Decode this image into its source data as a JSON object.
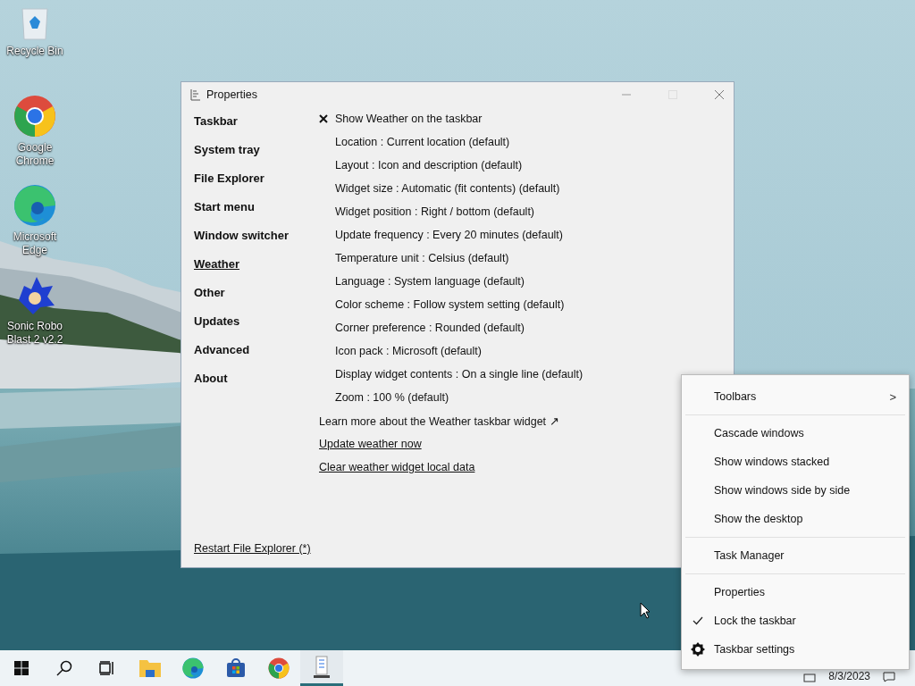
{
  "desktop_icons": [
    {
      "label": "Recycle Bin",
      "kind": "recycle"
    },
    {
      "label": "Google Chrome",
      "kind": "chrome"
    },
    {
      "label": "Microsoft Edge",
      "kind": "edge"
    },
    {
      "label": "Sonic Robo Blast 2 v2.2",
      "kind": "game"
    }
  ],
  "window": {
    "title": "Properties",
    "nav": [
      {
        "label": "Taskbar",
        "selected": false
      },
      {
        "label": "System tray",
        "selected": false
      },
      {
        "label": "File Explorer",
        "selected": false
      },
      {
        "label": "Start menu",
        "selected": false
      },
      {
        "label": "Window switcher",
        "selected": false
      },
      {
        "label": "Weather",
        "selected": true
      },
      {
        "label": "Other",
        "selected": false
      },
      {
        "label": "Updates",
        "selected": false
      },
      {
        "label": "Advanced",
        "selected": false
      },
      {
        "label": "About",
        "selected": false
      }
    ],
    "options": [
      {
        "kind": "toggle",
        "label": "Show Weather on the taskbar",
        "checked": true
      },
      {
        "kind": "setting",
        "label": "Location : Current location (default)"
      },
      {
        "kind": "setting",
        "label": "Layout : Icon and description (default)"
      },
      {
        "kind": "setting",
        "label": "Widget size : Automatic (fit contents) (default)"
      },
      {
        "kind": "setting",
        "label": "Widget position : Right / bottom (default)"
      },
      {
        "kind": "setting",
        "label": "Update frequency : Every 20 minutes (default)"
      },
      {
        "kind": "setting",
        "label": "Temperature unit : Celsius (default)"
      },
      {
        "kind": "setting",
        "label": "Language : System language (default)"
      },
      {
        "kind": "setting",
        "label": "Color scheme : Follow system setting (default)"
      },
      {
        "kind": "setting",
        "label": "Corner preference : Rounded (default)"
      },
      {
        "kind": "setting",
        "label": "Icon pack : Microsoft (default)"
      },
      {
        "kind": "setting",
        "label": "Display widget contents : On a single line (default)"
      },
      {
        "kind": "setting",
        "label": "Zoom : 100 % (default)"
      }
    ],
    "links": [
      {
        "kind": "external",
        "label": "Learn more about the Weather taskbar widget ↗"
      },
      {
        "kind": "action",
        "label": "Update weather now"
      },
      {
        "kind": "action",
        "label": "Clear weather widget local data"
      }
    ],
    "footer_link": "Restart File Explorer (*)"
  },
  "context_menu": {
    "groups": [
      {
        "items": [
          {
            "kind": "submenu",
            "label": "Toolbars",
            "arrow": ">"
          }
        ]
      },
      {
        "items": [
          {
            "kind": "plain",
            "label": "Cascade windows"
          },
          {
            "kind": "plain",
            "label": "Show windows stacked"
          },
          {
            "kind": "plain",
            "label": "Show windows side by side"
          },
          {
            "kind": "plain",
            "label": "Show the desktop"
          }
        ]
      },
      {
        "items": [
          {
            "kind": "plain",
            "label": "Task Manager"
          }
        ]
      },
      {
        "items": [
          {
            "kind": "plain",
            "label": "Properties"
          },
          {
            "kind": "check",
            "label": "Lock the taskbar",
            "checked": true
          },
          {
            "kind": "settings",
            "label": "Taskbar settings"
          }
        ]
      }
    ]
  },
  "taskbar": {
    "apps": [
      {
        "kind": "start",
        "active": false
      },
      {
        "kind": "search",
        "active": false
      },
      {
        "kind": "taskview",
        "active": false
      },
      {
        "kind": "folder",
        "active": false
      },
      {
        "kind": "edge",
        "active": false
      },
      {
        "kind": "store",
        "active": false
      },
      {
        "kind": "chrome",
        "active": false
      },
      {
        "kind": "properties",
        "active": true
      }
    ],
    "date": "8/3/2023"
  }
}
